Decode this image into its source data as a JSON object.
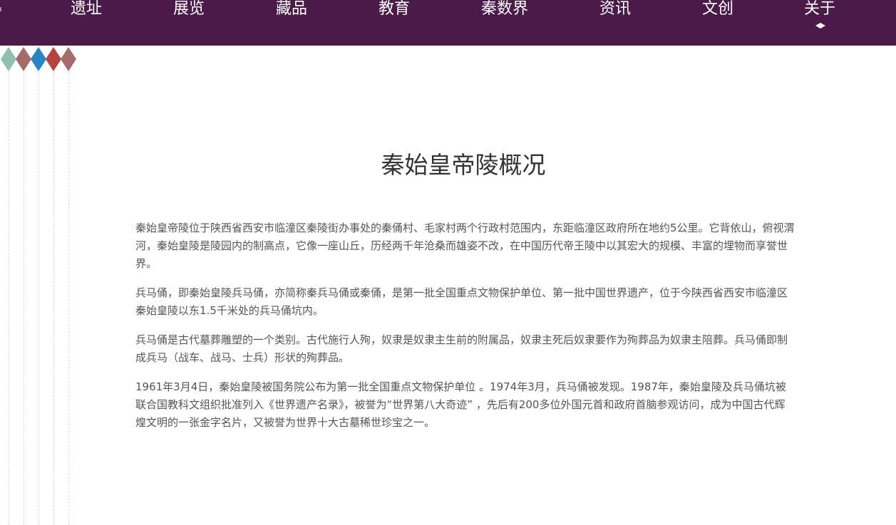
{
  "nav": {
    "items": [
      {
        "label": "遗址"
      },
      {
        "label": "展览"
      },
      {
        "label": "藏品"
      },
      {
        "label": "教育"
      },
      {
        "label": "秦数界"
      },
      {
        "label": "资讯"
      },
      {
        "label": "文创"
      },
      {
        "label": "关于"
      }
    ],
    "active_index": 7,
    "background_color": "#4a1a48"
  },
  "decoration": {
    "diamond_colors": [
      "#8fbfae",
      "#a56a6a",
      "#2784c6",
      "#b7433f",
      "#a56a6a"
    ]
  },
  "article": {
    "title": "秦始皇帝陵概况",
    "paragraphs": [
      "秦始皇帝陵位于陕西省西安市临潼区秦陵街办事处的秦俑村、毛家村两个行政村范围内，东距临潼区政府所在地约5公里。它背依山，俯视渭河，秦始皇陵是陵园内的制高点，它像一座山丘，历经两千年沧桑而雄姿不改，在中国历代帝王陵中以其宏大的规模、丰富的埋物而享誉世界。",
      "兵马俑，即秦始皇陵兵马俑，亦简称秦兵马俑或秦俑，是第一批全国重点文物保护单位、第一批中国世界遗产，位于今陕西省西安市临潼区秦始皇陵以东1.5千米处的兵马俑坑内。",
      "兵马俑是古代墓葬雕塑的一个类别。古代施行人殉，奴隶是奴隶主生前的附属品，奴隶主死后奴隶要作为殉葬品为奴隶主陪葬。兵马俑即制成兵马（战车、战马、士兵）形状的殉葬品。",
      "1961年3月4日，秦始皇陵被国务院公布为第一批全国重点文物保护单位  。1974年3月，兵马俑被发现。1987年，秦始皇陵及兵马俑坑被联合国教科文组织批准列入《世界遗产名录》，被誉为“世界第八大奇迹”  ，先后有200多位外国元首和政府首脑参观访问，成为中国古代辉煌文明的一张金字名片，又被誉为世界十大古墓稀世珍宝之一。"
    ]
  }
}
